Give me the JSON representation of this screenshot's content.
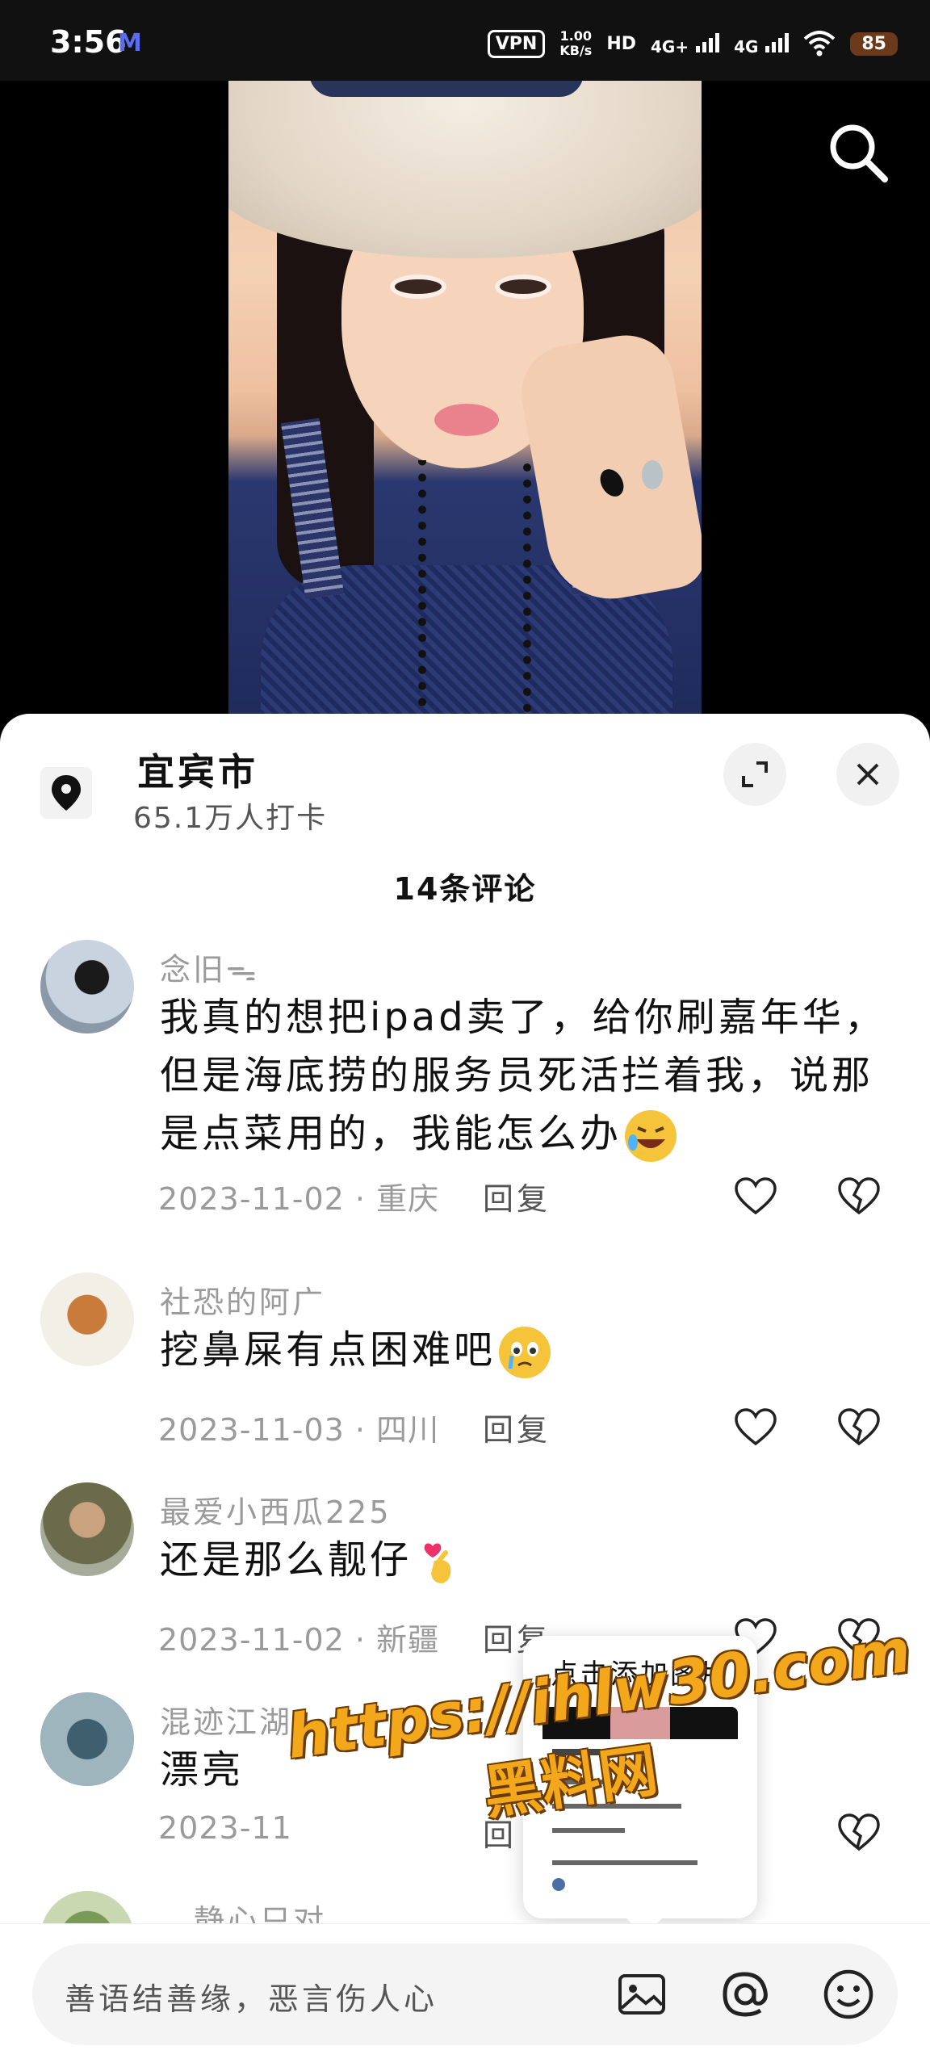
{
  "status_bar": {
    "time": "3:56",
    "app_icon": "M",
    "vpn": "VPN",
    "speed_value": "1.00",
    "speed_unit": "KB/s",
    "hd": "HD",
    "signal_1": "4G+",
    "signal_2": "4G",
    "battery": "85"
  },
  "location": {
    "name": "宜宾市",
    "checkins": "65.1万人打卡"
  },
  "comments_header": "14条评论",
  "comments": [
    {
      "user": "念旧ᯓ",
      "text": "我真的想把ipad卖了，给你刷嘉年华，但是海底捞的服务员死活拦着我，说那是点菜用的，我能怎么办",
      "date": "2023-11-02",
      "place": "重庆",
      "reply": "回复"
    },
    {
      "user": "社恐的阿广",
      "text": "挖鼻屎有点困难吧",
      "date": "2023-11-03",
      "place": "四川",
      "reply": "回复"
    },
    {
      "user": "最爱小西瓜225",
      "text": "还是那么靓仔",
      "date": "2023-11-02",
      "place": "新疆",
      "reply": "回复"
    },
    {
      "user": "混迹江湖",
      "text": "漂亮",
      "date": "2023-11",
      "place": "",
      "reply": "回"
    },
    {
      "user": "静心只对",
      "text": "",
      "date": "",
      "place": "",
      "reply": ""
    }
  ],
  "popup": {
    "title": "点击添加图片"
  },
  "input": {
    "placeholder": "善语结善缘，恶言伤人心"
  },
  "watermark": {
    "url": "https://ihlw30.com",
    "name": "黑料网"
  },
  "colors": {
    "accent_orange": "#f3a81c",
    "sheet_bg": "#ffffff",
    "muted_text": "#9a9a9a"
  }
}
